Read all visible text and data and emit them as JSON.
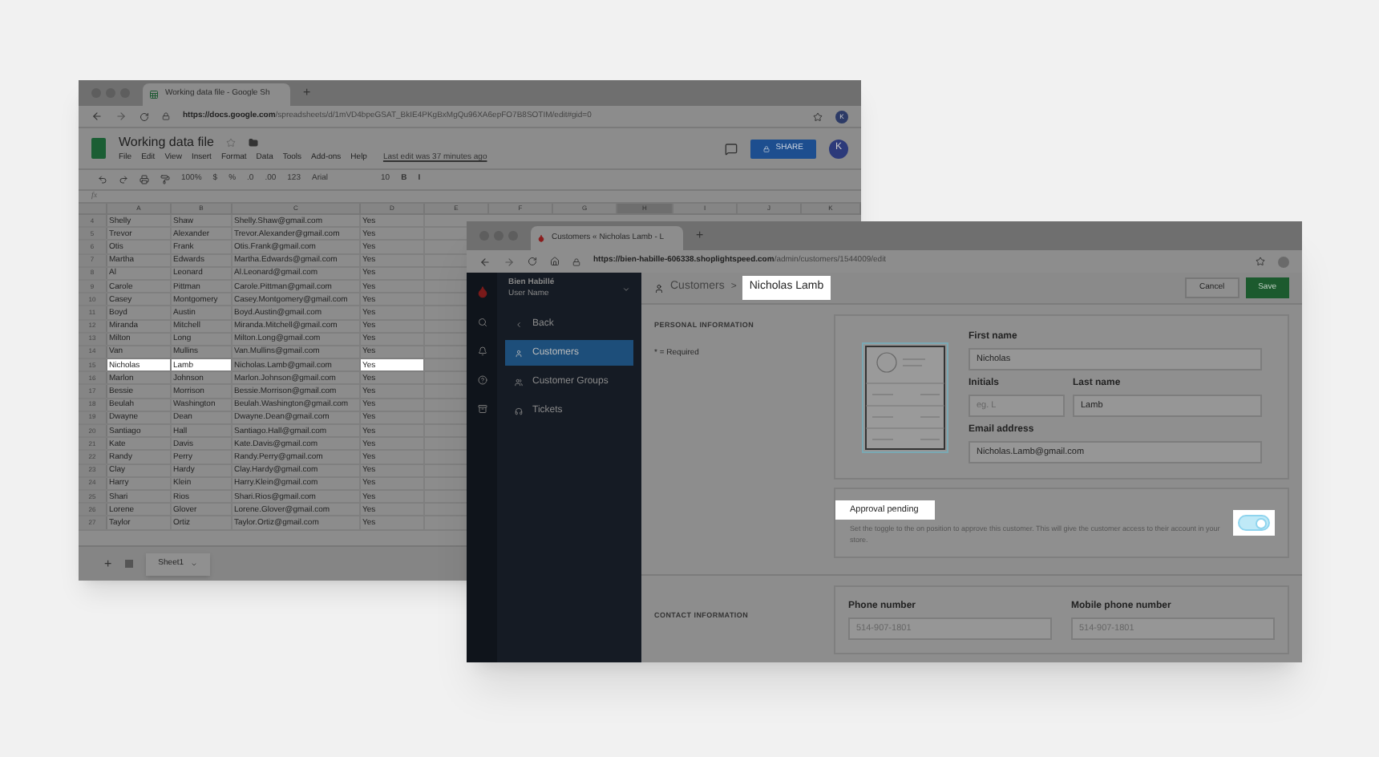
{
  "sheet_window": {
    "tab_title": "Working data file - Google Sh",
    "new_tab": "+",
    "url_host": "https://docs.google.com",
    "url_path": "/spreadsheets/d/1mVD4bpeGSAT_BkIE4PKgBxMgQu96XA6epFO7B8SOTIM/edit#gid=0",
    "profile": "K",
    "doc_title": "Working data file",
    "menus": [
      "File",
      "Edit",
      "View",
      "Insert",
      "Format",
      "Data",
      "Tools",
      "Add-ons",
      "Help"
    ],
    "last_edit": "Last edit was 37 minutes ago",
    "share": "SHARE",
    "avatar": "K",
    "toolbar": [
      "100%",
      "$",
      "%",
      ".0",
      ".00",
      "123",
      "Arial",
      "10",
      "B",
      "I"
    ],
    "fx": "fx",
    "columns": [
      {
        "label": "A",
        "selected": false
      },
      {
        "label": "B",
        "selected": false
      },
      {
        "label": "C",
        "selected": false
      },
      {
        "label": "D",
        "selected": false
      },
      {
        "label": "E",
        "selected": false
      },
      {
        "label": "F",
        "selected": false
      },
      {
        "label": "G",
        "selected": false
      },
      {
        "label": "H",
        "selected": true
      },
      {
        "label": "I",
        "selected": false
      },
      {
        "label": "J",
        "selected": false
      },
      {
        "label": "K",
        "selected": false
      }
    ],
    "rows": [
      {
        "number": "4",
        "cells": [
          {
            "text": "Shelly",
            "highlighted": false
          },
          {
            "text": "Shaw",
            "highlighted": false
          },
          {
            "text": "Shelly.Shaw@gmail.com",
            "highlighted": false
          },
          {
            "text": "Yes",
            "highlighted": false
          }
        ]
      },
      {
        "number": "5",
        "cells": [
          {
            "text": "Trevor",
            "highlighted": false
          },
          {
            "text": "Alexander",
            "highlighted": false
          },
          {
            "text": "Trevor.Alexander@gmail.com",
            "highlighted": false
          },
          {
            "text": "Yes",
            "highlighted": false
          }
        ]
      },
      {
        "number": "6",
        "cells": [
          {
            "text": "Otis",
            "highlighted": false
          },
          {
            "text": "Frank",
            "highlighted": false
          },
          {
            "text": "Otis.Frank@gmail.com",
            "highlighted": false
          },
          {
            "text": "Yes",
            "highlighted": false
          }
        ]
      },
      {
        "number": "7",
        "cells": [
          {
            "text": "Martha",
            "highlighted": false
          },
          {
            "text": "Edwards",
            "highlighted": false
          },
          {
            "text": "Martha.Edwards@gmail.com",
            "highlighted": false
          },
          {
            "text": "Yes",
            "highlighted": false
          }
        ]
      },
      {
        "number": "8",
        "cells": [
          {
            "text": "Al",
            "highlighted": false
          },
          {
            "text": "Leonard",
            "highlighted": false
          },
          {
            "text": "Al.Leonard@gmail.com",
            "highlighted": false
          },
          {
            "text": "Yes",
            "highlighted": false
          }
        ]
      },
      {
        "number": "9",
        "cells": [
          {
            "text": "Carole",
            "highlighted": false
          },
          {
            "text": "Pittman",
            "highlighted": false
          },
          {
            "text": "Carole.Pittman@gmail.com",
            "highlighted": false
          },
          {
            "text": "Yes",
            "highlighted": false
          }
        ]
      },
      {
        "number": "10",
        "cells": [
          {
            "text": "Casey",
            "highlighted": false
          },
          {
            "text": "Montgomery",
            "highlighted": false
          },
          {
            "text": "Casey.Montgomery@gmail.com",
            "highlighted": false
          },
          {
            "text": "Yes",
            "highlighted": false
          }
        ]
      },
      {
        "number": "11",
        "cells": [
          {
            "text": "Boyd",
            "highlighted": false
          },
          {
            "text": "Austin",
            "highlighted": false
          },
          {
            "text": "Boyd.Austin@gmail.com",
            "highlighted": false
          },
          {
            "text": "Yes",
            "highlighted": false
          }
        ]
      },
      {
        "number": "12",
        "cells": [
          {
            "text": "Miranda",
            "highlighted": false
          },
          {
            "text": "Mitchell",
            "highlighted": false
          },
          {
            "text": "Miranda.Mitchell@gmail.com",
            "highlighted": false
          },
          {
            "text": "Yes",
            "highlighted": false
          }
        ]
      },
      {
        "number": "13",
        "cells": [
          {
            "text": "Milton",
            "highlighted": false
          },
          {
            "text": "Long",
            "highlighted": false
          },
          {
            "text": "Milton.Long@gmail.com",
            "highlighted": false
          },
          {
            "text": "Yes",
            "highlighted": false
          }
        ]
      },
      {
        "number": "14",
        "cells": [
          {
            "text": "Van",
            "highlighted": false
          },
          {
            "text": "Mullins",
            "highlighted": false
          },
          {
            "text": "Van.Mullins@gmail.com",
            "highlighted": false
          },
          {
            "text": "Yes",
            "highlighted": false
          }
        ]
      },
      {
        "number": "15",
        "cells": [
          {
            "text": "Nicholas",
            "highlighted": true
          },
          {
            "text": "Lamb",
            "highlighted": true
          },
          {
            "text": "Nicholas.Lamb@gmail.com",
            "highlighted": false
          },
          {
            "text": "Yes",
            "highlighted": true
          }
        ]
      },
      {
        "number": "16",
        "cells": [
          {
            "text": "Marlon",
            "highlighted": false
          },
          {
            "text": "Johnson",
            "highlighted": false
          },
          {
            "text": "Marlon.Johnson@gmail.com",
            "highlighted": false
          },
          {
            "text": "Yes",
            "highlighted": false
          }
        ]
      },
      {
        "number": "17",
        "cells": [
          {
            "text": "Bessie",
            "highlighted": false
          },
          {
            "text": "Morrison",
            "highlighted": false
          },
          {
            "text": "Bessie.Morrison@gmail.com",
            "highlighted": false
          },
          {
            "text": "Yes",
            "highlighted": false
          }
        ]
      },
      {
        "number": "18",
        "cells": [
          {
            "text": "Beulah",
            "highlighted": false
          },
          {
            "text": "Washington",
            "highlighted": false
          },
          {
            "text": "Beulah.Washington@gmail.com",
            "highlighted": false
          },
          {
            "text": "Yes",
            "highlighted": false
          }
        ]
      },
      {
        "number": "19",
        "cells": [
          {
            "text": "Dwayne",
            "highlighted": false
          },
          {
            "text": "Dean",
            "highlighted": false
          },
          {
            "text": "Dwayne.Dean@gmail.com",
            "highlighted": false
          },
          {
            "text": "Yes",
            "highlighted": false
          }
        ]
      },
      {
        "number": "20",
        "cells": [
          {
            "text": "Santiago",
            "highlighted": false
          },
          {
            "text": "Hall",
            "highlighted": false
          },
          {
            "text": "Santiago.Hall@gmail.com",
            "highlighted": false
          },
          {
            "text": "Yes",
            "highlighted": false
          }
        ]
      },
      {
        "number": "21",
        "cells": [
          {
            "text": "Kate",
            "highlighted": false
          },
          {
            "text": "Davis",
            "highlighted": false
          },
          {
            "text": "Kate.Davis@gmail.com",
            "highlighted": false
          },
          {
            "text": "Yes",
            "highlighted": false
          }
        ]
      },
      {
        "number": "22",
        "cells": [
          {
            "text": "Randy",
            "highlighted": false
          },
          {
            "text": "Perry",
            "highlighted": false
          },
          {
            "text": "Randy.Perry@gmail.com",
            "highlighted": false
          },
          {
            "text": "Yes",
            "highlighted": false
          }
        ]
      },
      {
        "number": "23",
        "cells": [
          {
            "text": "Clay",
            "highlighted": false
          },
          {
            "text": "Hardy",
            "highlighted": false
          },
          {
            "text": "Clay.Hardy@gmail.com",
            "highlighted": false
          },
          {
            "text": "Yes",
            "highlighted": false
          }
        ]
      },
      {
        "number": "24",
        "cells": [
          {
            "text": "Harry",
            "highlighted": false
          },
          {
            "text": "Klein",
            "highlighted": false
          },
          {
            "text": "Harry.Klein@gmail.com",
            "highlighted": false
          },
          {
            "text": "Yes",
            "highlighted": false
          }
        ]
      },
      {
        "number": "25",
        "cells": [
          {
            "text": "Shari",
            "highlighted": false
          },
          {
            "text": "Rios",
            "highlighted": false
          },
          {
            "text": "Shari.Rios@gmail.com",
            "highlighted": false
          },
          {
            "text": "Yes",
            "highlighted": false
          }
        ]
      },
      {
        "number": "26",
        "cells": [
          {
            "text": "Lorene",
            "highlighted": false
          },
          {
            "text": "Glover",
            "highlighted": false
          },
          {
            "text": "Lorene.Glover@gmail.com",
            "highlighted": false
          },
          {
            "text": "Yes",
            "highlighted": false
          }
        ]
      },
      {
        "number": "27",
        "cells": [
          {
            "text": "Taylor",
            "highlighted": false
          },
          {
            "text": "Ortiz",
            "highlighted": false
          },
          {
            "text": "Taylor.Ortiz@gmail.com",
            "highlighted": false
          },
          {
            "text": "Yes",
            "highlighted": false
          }
        ]
      }
    ],
    "add_sheet": "+",
    "sheet_tabs": [
      {
        "label": "Sheet1"
      }
    ]
  },
  "admin_window": {
    "tab_title": "Customers « Nicholas Lamb - L",
    "new_tab": "+",
    "url_host": "https://bien-habille-606338.shoplightspeed.com",
    "url_path": "/admin/customers/1544009/edit",
    "store_name": "Bien Habillé",
    "user_name": "User Name",
    "nav": [
      {
        "kind": "back",
        "label": "Back",
        "selected": false
      },
      {
        "kind": "customers",
        "label": "Customers",
        "selected": true
      },
      {
        "kind": "groups",
        "label": "Customer Groups",
        "selected": false
      },
      {
        "kind": "tickets",
        "label": "Tickets",
        "selected": false
      }
    ],
    "breadcrumb": {
      "parent": "Customers",
      "separator": ">",
      "current": "Nicholas Lamb",
      "highlighted": true
    },
    "buttons": {
      "cancel": "Cancel",
      "save": "Save"
    },
    "personal": {
      "heading": "PERSONAL INFORMATION",
      "note": "* = Required",
      "first_name": {
        "label": "First name",
        "value": "Nicholas"
      },
      "initials": {
        "label": "Initials",
        "placeholder": "eg. L"
      },
      "last_name": {
        "label": "Last name",
        "value": "Lamb"
      },
      "email": {
        "label": "Email address",
        "value": "Nicholas.Lamb@gmail.com"
      }
    },
    "approval": {
      "title": "Approval pending",
      "highlighted": true,
      "description": "Set the toggle to the on position to approve this customer. This will give the customer access to their account in your store.",
      "on": true
    },
    "contact": {
      "heading": "CONTACT INFORMATION",
      "phone": {
        "label": "Phone number",
        "placeholder": "514-907-1801"
      },
      "mobile": {
        "label": "Mobile phone number",
        "placeholder": "514-907-1801"
      }
    }
  }
}
